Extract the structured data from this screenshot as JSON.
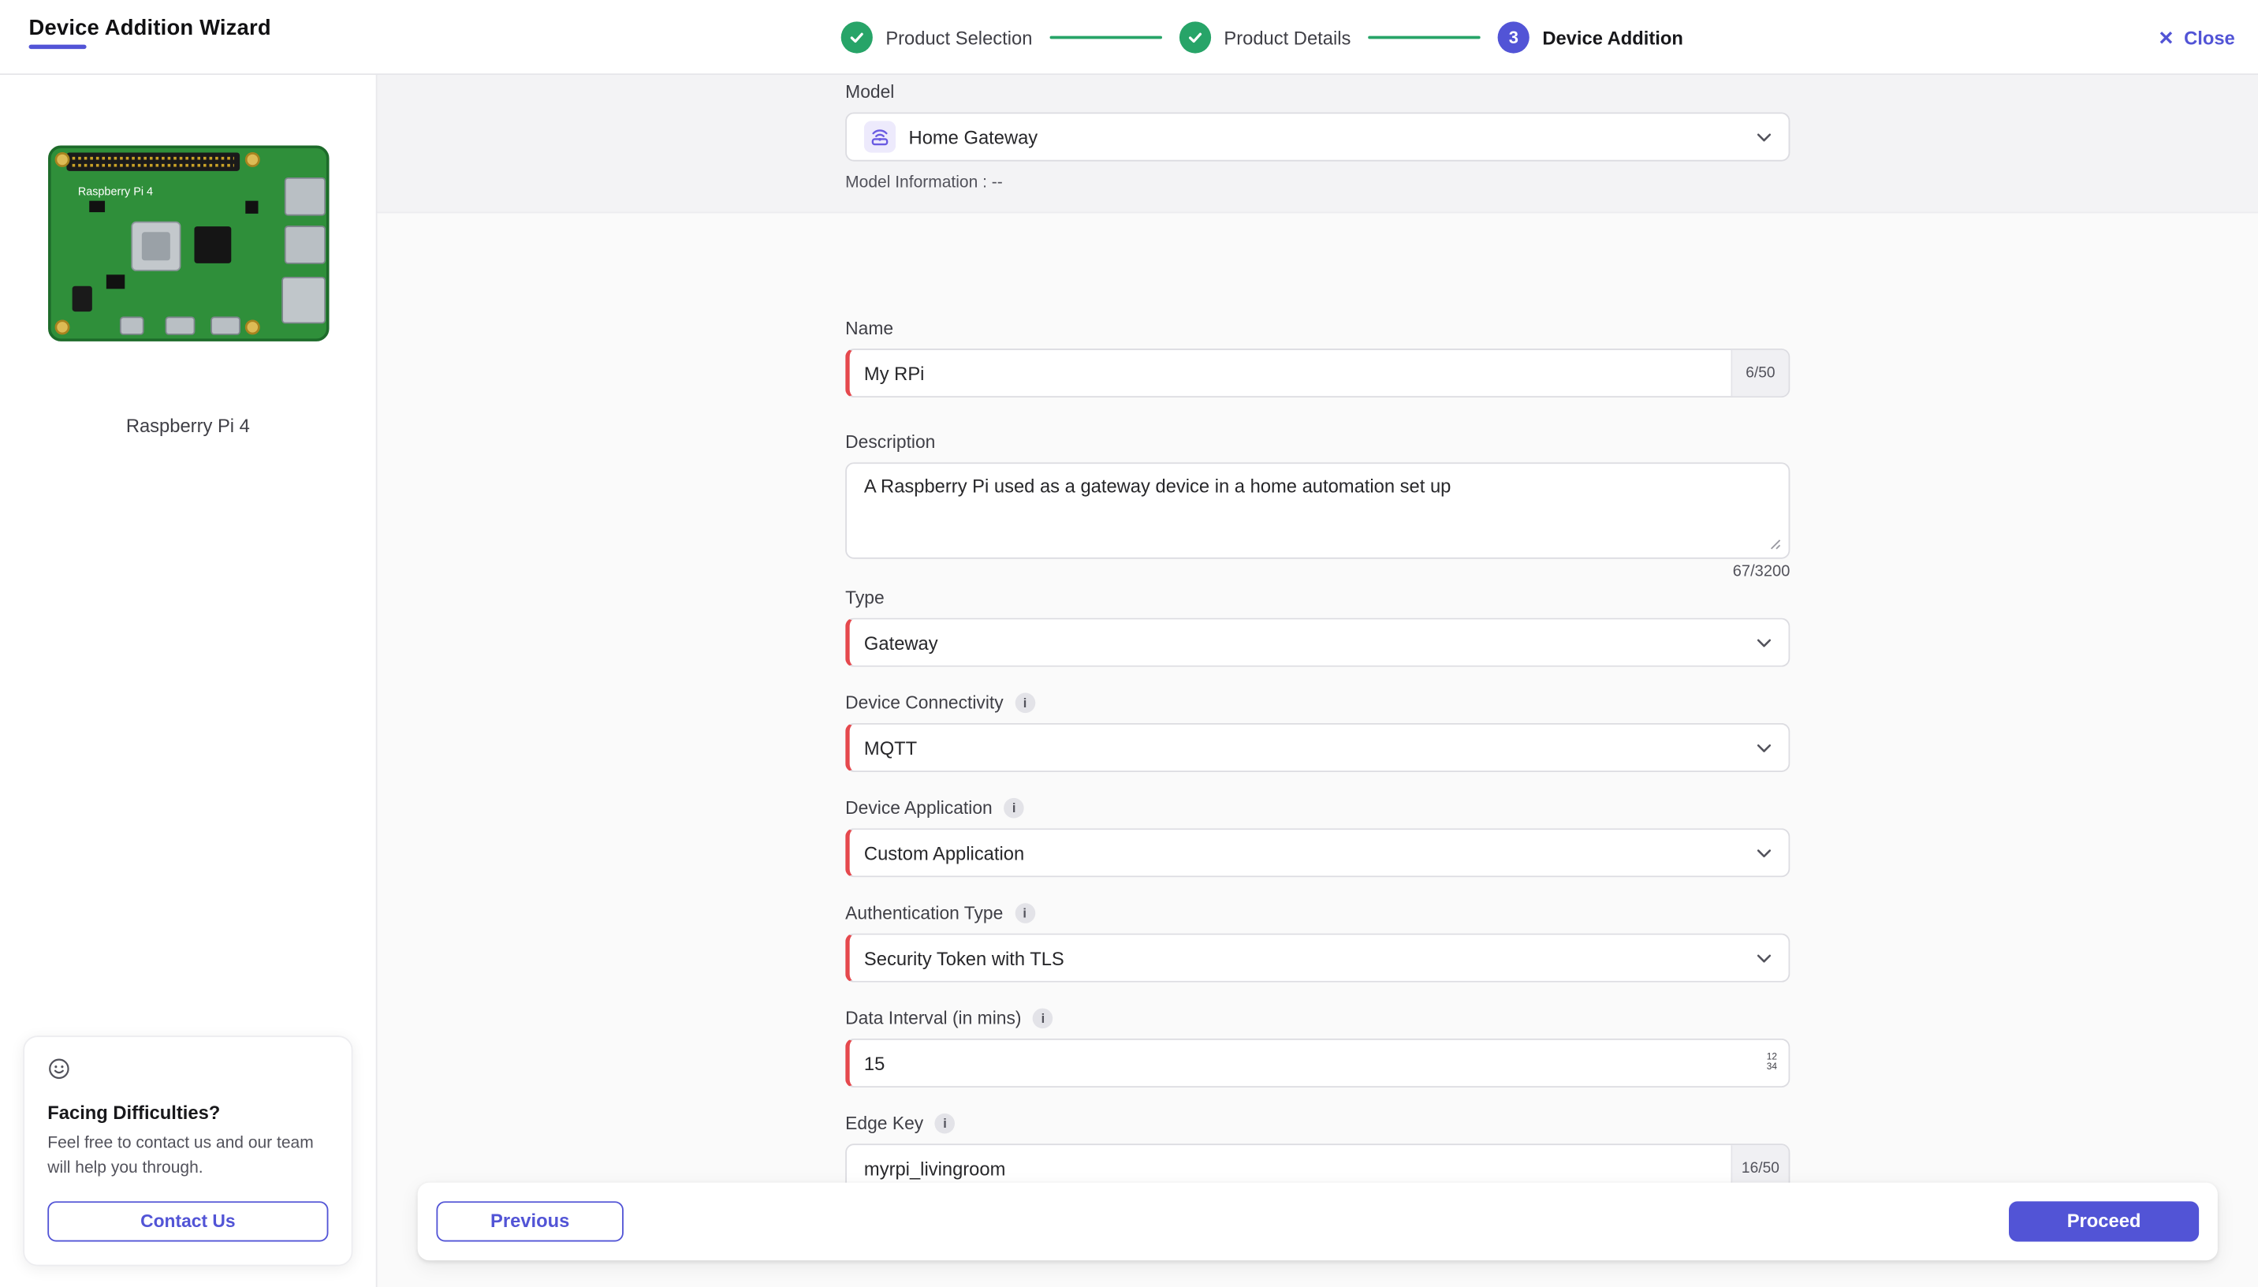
{
  "header": {
    "title": "Device Addition Wizard",
    "close_label": "Close",
    "steps": [
      {
        "label": "Product Selection",
        "state": "complete"
      },
      {
        "label": "Product Details",
        "state": "complete"
      },
      {
        "label": "Device Addition",
        "state": "current",
        "number": "3"
      }
    ]
  },
  "sidebar": {
    "product_name": "Raspberry Pi 4",
    "help": {
      "title": "Facing Difficulties?",
      "body": "Feel free to contact us and our team will help you through.",
      "contact_label": "Contact Us"
    }
  },
  "model_section": {
    "label": "Model",
    "value": "Home Gateway",
    "info": "Model Information : --"
  },
  "form": {
    "name": {
      "label": "Name",
      "value": "My RPi",
      "counter": "6/50"
    },
    "description": {
      "label": "Description",
      "value": "A Raspberry Pi used as a gateway device in a home automation set up",
      "counter": "67/3200"
    },
    "type": {
      "label": "Type",
      "value": "Gateway"
    },
    "connectivity": {
      "label": "Device Connectivity",
      "value": "MQTT"
    },
    "application": {
      "label": "Device Application",
      "value": "Custom Application"
    },
    "auth": {
      "label": "Authentication Type",
      "value": "Security Token with TLS"
    },
    "interval": {
      "label": "Data Interval (in mins)",
      "value": "15",
      "stepper_top": "12",
      "stepper_bottom": "34"
    },
    "edge_key": {
      "label": "Edge Key",
      "value": "myrpi_livingroom",
      "counter": "16/50"
    }
  },
  "footer": {
    "previous_label": "Previous",
    "proceed_label": "Proceed"
  },
  "icons": {
    "info": "i",
    "close": "✕"
  },
  "colors": {
    "accent": "#5254d6",
    "success": "#27a468",
    "error": "#e5484d"
  }
}
